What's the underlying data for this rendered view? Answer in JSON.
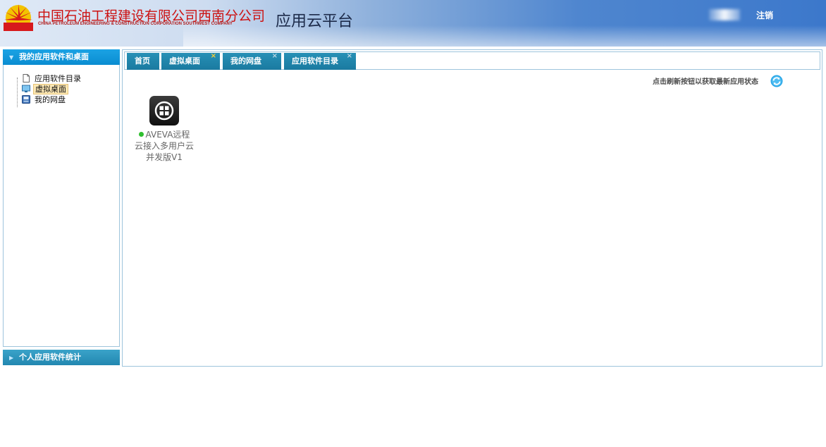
{
  "header": {
    "company_name_cn": "中国石油工程建设有限公司西南分公司",
    "company_name_en": "CHINA PETROLEUM ENGINEERING & CONSTRUCTION CORPORATION SOUTHWEST COMPANY",
    "platform_title": "应用云平台",
    "logout_label": "注销"
  },
  "sidebar": {
    "section_top": "我的应用软件和桌面",
    "tree": [
      {
        "label": "应用软件目录",
        "icon": "document-icon",
        "selected": false
      },
      {
        "label": "虚拟桌面",
        "icon": "monitor-icon",
        "selected": true
      },
      {
        "label": "我的网盘",
        "icon": "disk-icon",
        "selected": false
      }
    ],
    "section_bottom": "个人应用软件统计"
  },
  "tabs": [
    {
      "label": "首页",
      "closable": false,
      "active": false
    },
    {
      "label": "虚拟桌面",
      "closable": true,
      "active": true
    },
    {
      "label": "我的网盘",
      "closable": true,
      "active": false
    },
    {
      "label": "应用软件目录",
      "closable": true,
      "active": false
    }
  ],
  "close_glyph": "×",
  "main": {
    "refresh_hint": "点击刷新按钮以获取最新应用状态",
    "apps": [
      {
        "name_lines": [
          "AVEVA远程",
          "云接入多用户云",
          "并发版V1"
        ],
        "status": "online",
        "icon": "windows-icon"
      }
    ]
  },
  "colors": {
    "accent": "#0a8cd1",
    "tab": "#1a7aa0",
    "status_online": "#2fbf2f",
    "company_red": "#cc1111"
  }
}
